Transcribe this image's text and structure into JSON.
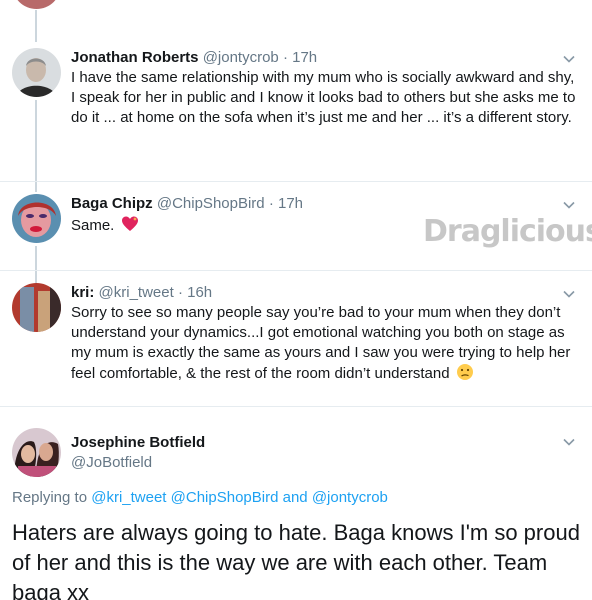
{
  "tweets": [
    {
      "name": "Jonathan Roberts",
      "handle": "@jontycrob",
      "sep": "·",
      "time": "17h",
      "text": "I have the same relationship with my mum who is socially awkward and shy, I speak for her in public and I know it looks bad to others but she asks me to do it ... at home on the sofa when it’s just me and her ... it’s a different story."
    },
    {
      "name": "Baga Chipz",
      "handle": "@ChipShopBird",
      "sep": "·",
      "time": "17h",
      "text": "Same.",
      "emoji": "sparkling-heart"
    },
    {
      "name": "kri:",
      "handle": "@kri_tweet",
      "sep": "·",
      "time": "16h",
      "text": "Sorry to see so many people say you’re bad to your mum when they don’t understand your dynamics...I got emotional watching you both on stage as my mum is exactly the same as yours and I saw you were trying to help her feel comfortable, & the rest of the room didn’t understand",
      "emoji": "confused-face"
    }
  ],
  "main_tweet": {
    "name": "Josephine Botfield",
    "handle": "@JoBotfield",
    "replying_prefix": "Replying to",
    "replying_1": "@kri_tweet",
    "replying_2": "@ChipShopBird",
    "replying_and": "and",
    "replying_3": "@jontycrob",
    "text": "Haters are always going to hate. Baga knows I'm so proud of her and this is the way we are with each other. Team baga xx"
  },
  "watermark": "Draglicious",
  "colors": {
    "text": "#14171a",
    "muted": "#657786",
    "link": "#1da1f2",
    "thread_line": "#ccd6dd"
  },
  "icons": [
    "chevron-down-icon",
    "sparkling-heart-emoji",
    "confused-face-emoji"
  ]
}
